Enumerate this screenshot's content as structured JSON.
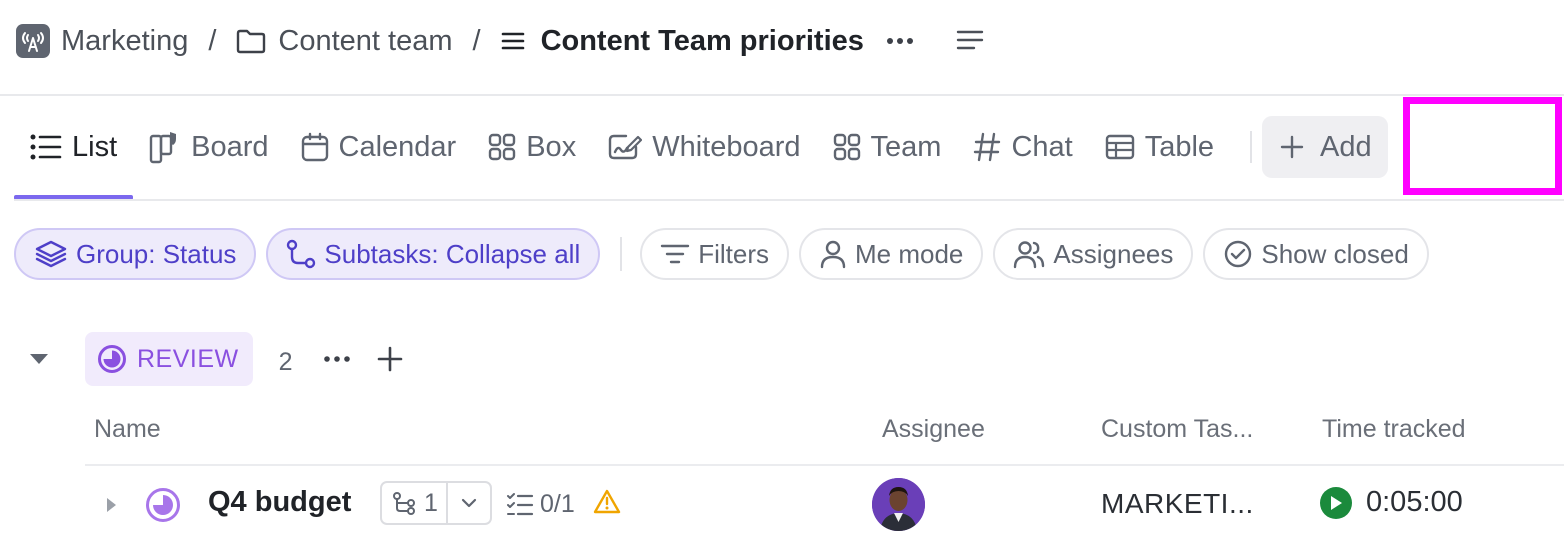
{
  "breadcrumb": {
    "workspace": "Marketing",
    "separator1": "/",
    "folder": "Content team",
    "separator2": "/",
    "list": "Content Team priorities"
  },
  "tabs": [
    {
      "label": "List",
      "icon": "list-icon",
      "active": true
    },
    {
      "label": "Board",
      "icon": "board-icon"
    },
    {
      "label": "Calendar",
      "icon": "calendar-icon"
    },
    {
      "label": "Box",
      "icon": "box-icon"
    },
    {
      "label": "Whiteboard",
      "icon": "whiteboard-icon"
    },
    {
      "label": "Team",
      "icon": "team-icon"
    },
    {
      "label": "Chat",
      "icon": "hash-icon"
    },
    {
      "label": "Table",
      "icon": "table-icon"
    }
  ],
  "add_view": {
    "label": "Add"
  },
  "filters": {
    "group": "Group: Status",
    "subtasks": "Subtasks: Collapse all",
    "filters": "Filters",
    "me_mode": "Me mode",
    "assignees": "Assignees",
    "show_closed": "Show closed"
  },
  "group": {
    "status": "REVIEW",
    "count": "2",
    "status_color": "#8a50e0"
  },
  "columns": {
    "name": "Name",
    "assignee": "Assignee",
    "custom": "Custom Tas...",
    "time": "Time tracked"
  },
  "tasks": [
    {
      "name": "Q4 budget",
      "subtasks": "1",
      "checklist": "0/1",
      "custom_value": "MARKETI...",
      "time_tracked": "0:05:00"
    }
  ],
  "colors": {
    "accent": "#7b68ee",
    "highlight": "#ff00ff",
    "play": "#1b8a3c",
    "warning": "#f0a500"
  }
}
